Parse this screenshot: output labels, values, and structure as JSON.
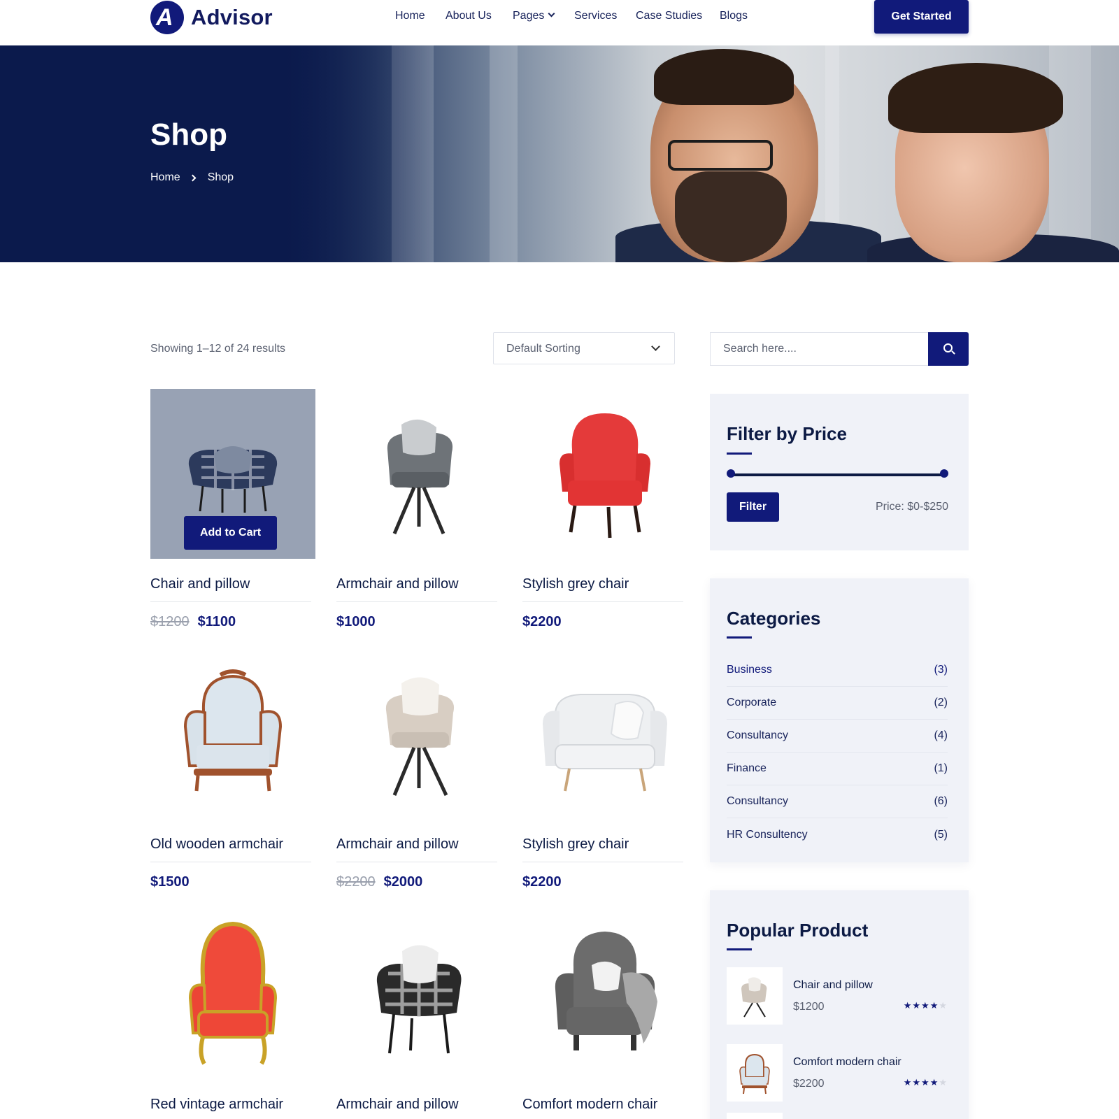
{
  "header": {
    "logo_text": "Advisor",
    "nav": [
      {
        "label": "Home"
      },
      {
        "label": "About Us"
      },
      {
        "label": "Pages",
        "has_dropdown": true
      },
      {
        "label": "Services"
      },
      {
        "label": "Case Studies"
      },
      {
        "label": "Blogs"
      }
    ],
    "cta_label": "Get Started"
  },
  "hero": {
    "title": "Shop",
    "breadcrumb": [
      "Home",
      "Shop"
    ]
  },
  "toolbar": {
    "results_text": "Showing 1–12 of 24 results",
    "sort_value": "Default Sorting",
    "search_placeholder": "Search here...."
  },
  "products": [
    {
      "name": "Chair and pillow",
      "old_price": "$1200",
      "price": "$1100",
      "hover": true,
      "add_to_cart": "Add to Cart"
    },
    {
      "name": "Armchair and pillow",
      "old_price": "",
      "price": "$1000"
    },
    {
      "name": "Stylish grey chair",
      "old_price": "",
      "price": "$2200"
    },
    {
      "name": "Old wooden armchair",
      "old_price": "",
      "price": "$1500"
    },
    {
      "name": "Armchair and pillow",
      "old_price": "$2200",
      "price": "$2000"
    },
    {
      "name": "Stylish grey chair",
      "old_price": "",
      "price": "$2200"
    },
    {
      "name": "Red vintage armchair",
      "old_price": "",
      "price": ""
    },
    {
      "name": "Armchair and pillow",
      "old_price": "",
      "price": ""
    },
    {
      "name": "Comfort modern chair",
      "old_price": "",
      "price": ""
    }
  ],
  "filter": {
    "title": "Filter by Price",
    "button_label": "Filter",
    "price_label": "Price: $0-$250",
    "range_fraction": [
      0,
      1
    ]
  },
  "categories": {
    "title": "Categories",
    "items": [
      {
        "name": "Business",
        "count": "(3)",
        "active": true
      },
      {
        "name": "Corporate",
        "count": "(2)"
      },
      {
        "name": "Consultancy",
        "count": "(4)"
      },
      {
        "name": "Finance",
        "count": "(1)"
      },
      {
        "name": "Consultancy",
        "count": "(6)"
      },
      {
        "name": "HR Consultency",
        "count": "(5)"
      }
    ]
  },
  "popular": {
    "title": "Popular Product",
    "items": [
      {
        "name": "Chair and pillow",
        "price": "$1200",
        "rating": 4,
        "max": 5
      },
      {
        "name": "Comfort modern chair",
        "price": "$2200",
        "rating": 4,
        "max": 5
      }
    ]
  },
  "colors": {
    "brand": "#111a7a",
    "hero_dark": "#0b1a4c",
    "text_dark": "#0c1a44",
    "muted": "#5a6070",
    "sidebar_bg": "#f0f2f8"
  },
  "icons": {
    "logo": "logo-a-icon",
    "pages_dropdown": "chevron-down-icon",
    "breadcrumb_separator": "chevron-right-icon",
    "sort_dropdown": "chevron-down-icon",
    "search": "search-icon",
    "rating": "star-icon"
  }
}
